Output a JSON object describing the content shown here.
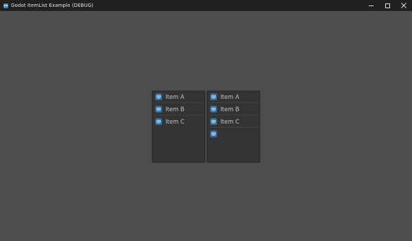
{
  "window": {
    "title": "Godot ItemList Example (DEBUG)",
    "icon": "godot-icon"
  },
  "colors": {
    "background": "#4d4d4d",
    "titlebar": "#202020",
    "list_background": "#333333",
    "item_text": "#c6c6c6",
    "icon_blue": "#478cbf"
  },
  "lists": [
    {
      "items": [
        {
          "label": "Item A",
          "icon": "godot-icon"
        },
        {
          "label": "Item B",
          "icon": "godot-icon"
        },
        {
          "label": "Item C",
          "icon": "godot-icon"
        }
      ]
    },
    {
      "items": [
        {
          "label": "Item A",
          "icon": "godot-icon"
        },
        {
          "label": "Item B",
          "icon": "godot-icon"
        },
        {
          "label": "Item C",
          "icon": "godot-icon"
        },
        {
          "label": "",
          "icon": "godot-icon"
        }
      ]
    }
  ]
}
